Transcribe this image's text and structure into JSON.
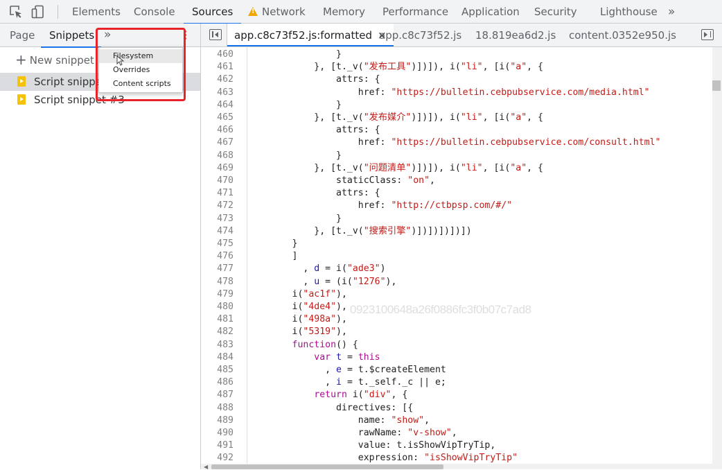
{
  "toolbar": {
    "inspect_icon": "inspect-element-icon",
    "device_icon": "device-toggle-icon",
    "tabs": [
      {
        "label": "Elements"
      },
      {
        "label": "Console"
      },
      {
        "label": "Sources"
      },
      {
        "label": "Network"
      },
      {
        "label": "Memory"
      },
      {
        "label": "Performance"
      },
      {
        "label": "Application"
      },
      {
        "label": "Security"
      },
      {
        "label": "Lighthouse"
      }
    ],
    "overflow_label": "»",
    "active_tab": "Sources"
  },
  "navigator": {
    "tabs": [
      {
        "label": "Page"
      },
      {
        "label": "Snippets"
      }
    ],
    "more_label": "»",
    "new_snippet_plus": "+",
    "new_snippet_label": "New snippet",
    "snippets": [
      {
        "label": "Script snippet #4",
        "selected": true
      },
      {
        "label": "Script snippet #3",
        "selected": false
      }
    ],
    "menu": {
      "items": [
        {
          "label": "Filesystem"
        },
        {
          "label": "Overrides"
        },
        {
          "label": "Content scripts"
        }
      ]
    }
  },
  "editor": {
    "tabs": [
      {
        "label": "app.c8c73f52.js:formatted",
        "close": "×"
      },
      {
        "label": "app.c8c73f52.js"
      },
      {
        "label": "18.819ea6d2.js"
      },
      {
        "label": "content.0352e950.js"
      }
    ],
    "watermark": "0923100648a26f0886fc3f0b07c7ad8",
    "lines": [
      {
        "n": "460",
        "t": "                }"
      },
      {
        "n": "461",
        "t": "            }, [t._v(\"发布工具\")])]), i(\"li\", [i(\"a\", {"
      },
      {
        "n": "462",
        "t": "                attrs: {"
      },
      {
        "n": "463",
        "t": "                    href: \"https://bulletin.cebpubservice.com/media.html\""
      },
      {
        "n": "464",
        "t": "                }"
      },
      {
        "n": "465",
        "t": "            }, [t._v(\"发布媒介\")])]), i(\"li\", [i(\"a\", {"
      },
      {
        "n": "466",
        "t": "                attrs: {"
      },
      {
        "n": "467",
        "t": "                    href: \"https://bulletin.cebpubservice.com/consult.html\""
      },
      {
        "n": "468",
        "t": "                }"
      },
      {
        "n": "469",
        "t": "            }, [t._v(\"问题清单\")])]), i(\"li\", [i(\"a\", {"
      },
      {
        "n": "470",
        "t": "                staticClass: \"on\","
      },
      {
        "n": "471",
        "t": "                attrs: {"
      },
      {
        "n": "472",
        "t": "                    href: \"http://ctbpsp.com/#/\""
      },
      {
        "n": "473",
        "t": "                }"
      },
      {
        "n": "474",
        "t": "            }, [t._v(\"搜索引擎\")])])])])])"
      },
      {
        "n": "475",
        "t": "        }"
      },
      {
        "n": "476",
        "t": "        ]"
      },
      {
        "n": "477",
        "t": "          , d = i(\"ade3\")"
      },
      {
        "n": "478",
        "t": "          , u = (i(\"1276\"),"
      },
      {
        "n": "479",
        "t": "        i(\"ac1f\"),"
      },
      {
        "n": "480",
        "t": "        i(\"4de4\"),"
      },
      {
        "n": "481",
        "t": "        i(\"498a\"),"
      },
      {
        "n": "482",
        "t": "        i(\"5319\"),"
      },
      {
        "n": "483",
        "t": "        function() {"
      },
      {
        "n": "484",
        "t": "            var t = this"
      },
      {
        "n": "485",
        "t": "              , e = t.$createElement"
      },
      {
        "n": "486",
        "t": "              , i = t._self._c || e;"
      },
      {
        "n": "487",
        "t": "            return i(\"div\", {"
      },
      {
        "n": "488",
        "t": "                directives: [{"
      },
      {
        "n": "489",
        "t": "                    name: \"show\","
      },
      {
        "n": "490",
        "t": "                    rawName: \"v-show\","
      },
      {
        "n": "491",
        "t": "                    value: t.isShowVipTryTip,"
      },
      {
        "n": "492",
        "t": "                    expression: \"isShowVipTryTip\""
      }
    ]
  },
  "colors": {
    "accent": "#1a73e8",
    "highlight_box": "#e8232a",
    "string": "#c41a16",
    "keyword": "#aa0d91",
    "warning": "#f2a600"
  }
}
